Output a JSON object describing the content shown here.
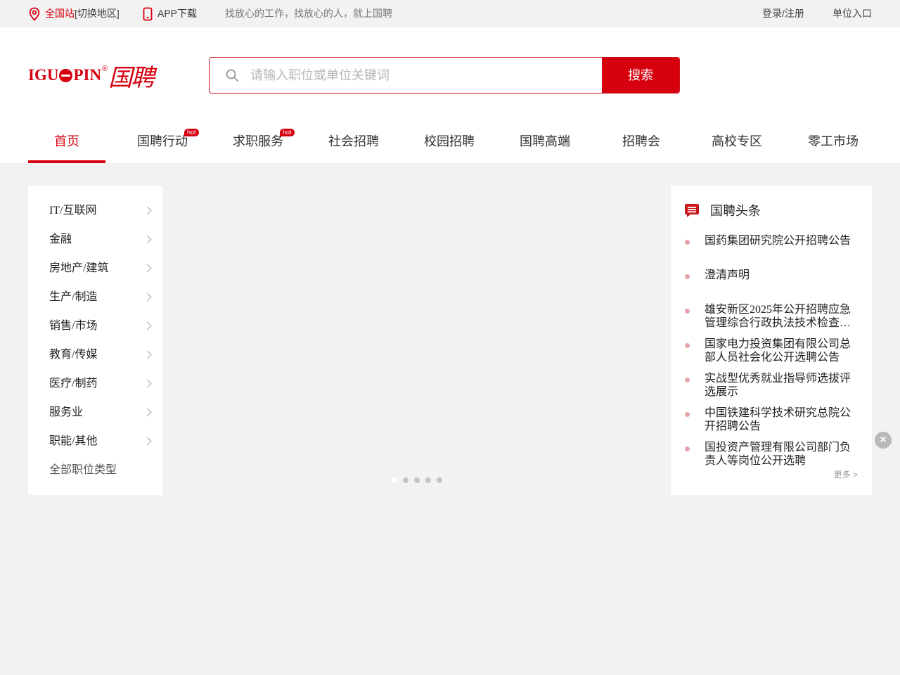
{
  "topbar": {
    "site_label": "全国站",
    "switch_label": "[切换地区]",
    "app_label": "APP下载",
    "slogan": "找放心的工作，找放心的人，就上国聘",
    "login_label": "登录/注册",
    "employer_label": "单位入口"
  },
  "brand": {
    "logo_latin_left": "IGU",
    "logo_latin_right": "PIN",
    "logo_reg": "®",
    "logo_cn": "国聘",
    "color": "#d7000f"
  },
  "search": {
    "placeholder": "请输入职位或单位关键词",
    "button_label": "搜索"
  },
  "nav": {
    "tabs": [
      {
        "label": "首页",
        "active": true
      },
      {
        "label": "国聘行动",
        "badge": "hot"
      },
      {
        "label": "求职服务",
        "badge": "hot"
      },
      {
        "label": "社会招聘"
      },
      {
        "label": "校园招聘"
      },
      {
        "label": "国聘高端"
      },
      {
        "label": "招聘会"
      },
      {
        "label": "高校专区"
      },
      {
        "label": "零工市场"
      }
    ]
  },
  "categories": {
    "items": [
      "IT/互联网",
      "金融",
      "房地产/建筑",
      "生产/制造",
      "销售/市场",
      "教育/传媒",
      "医疗/制药",
      "服务业",
      "职能/其他"
    ],
    "all_label": "全部职位类型"
  },
  "carousel": {
    "dot_count": 5,
    "active_index": 0
  },
  "news": {
    "title": "国聘头条",
    "items": [
      "国药集团研究院公开招聘公告",
      "澄清声明",
      "雄安新区2025年公开招聘应急管理综合行政执法技术检查…",
      "国家电力投资集团有限公司总部人员社会化公开选聘公告",
      "实战型优秀就业指导师选拔评选展示",
      "中国铁建科学技术研究总院公开招聘公告",
      "国投资产管理有限公司部门负责人等岗位公开选聘"
    ],
    "more_label": "更多 >"
  },
  "close_label": "×"
}
